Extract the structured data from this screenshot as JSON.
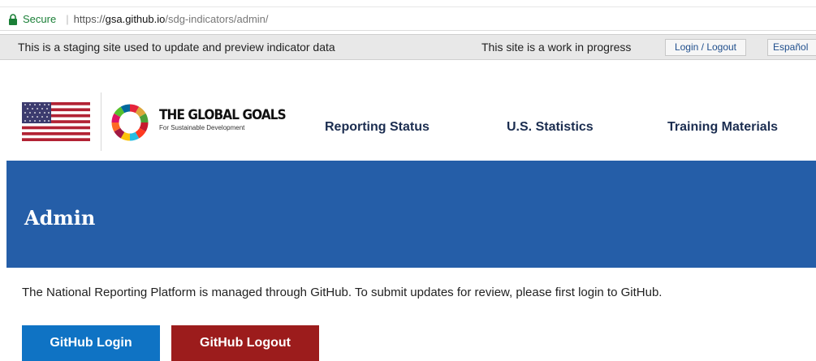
{
  "browser": {
    "secure_label": "Secure",
    "url_scheme": "https://",
    "url_host": "gsa.github.io",
    "url_path": "/sdg-indicators/admin/"
  },
  "staging_bar": {
    "notice": "This is a staging site used to update and preview indicator data",
    "wip_notice": "This site is a work in progress",
    "login_logout_label": "Login / Logout",
    "language_label": "Español"
  },
  "header": {
    "logo_title": "THE GLOBAL GOALS",
    "logo_subtitle": "For Sustainable Development",
    "nav": {
      "reporting_status": "Reporting Status",
      "us_statistics": "U.S. Statistics",
      "training_materials": "Training Materials"
    }
  },
  "banner": {
    "title": "Admin",
    "background_color": "#255ea8"
  },
  "main": {
    "intro": "The National Reporting Platform is managed through GitHub. To submit updates for review, please first login to GitHub.",
    "github_login_label": "GitHub Login",
    "github_logout_label": "GitHub Logout"
  },
  "colors": {
    "login_button": "#0f73c4",
    "logout_button": "#9c1c1c",
    "nav_text": "#1b2d50"
  }
}
